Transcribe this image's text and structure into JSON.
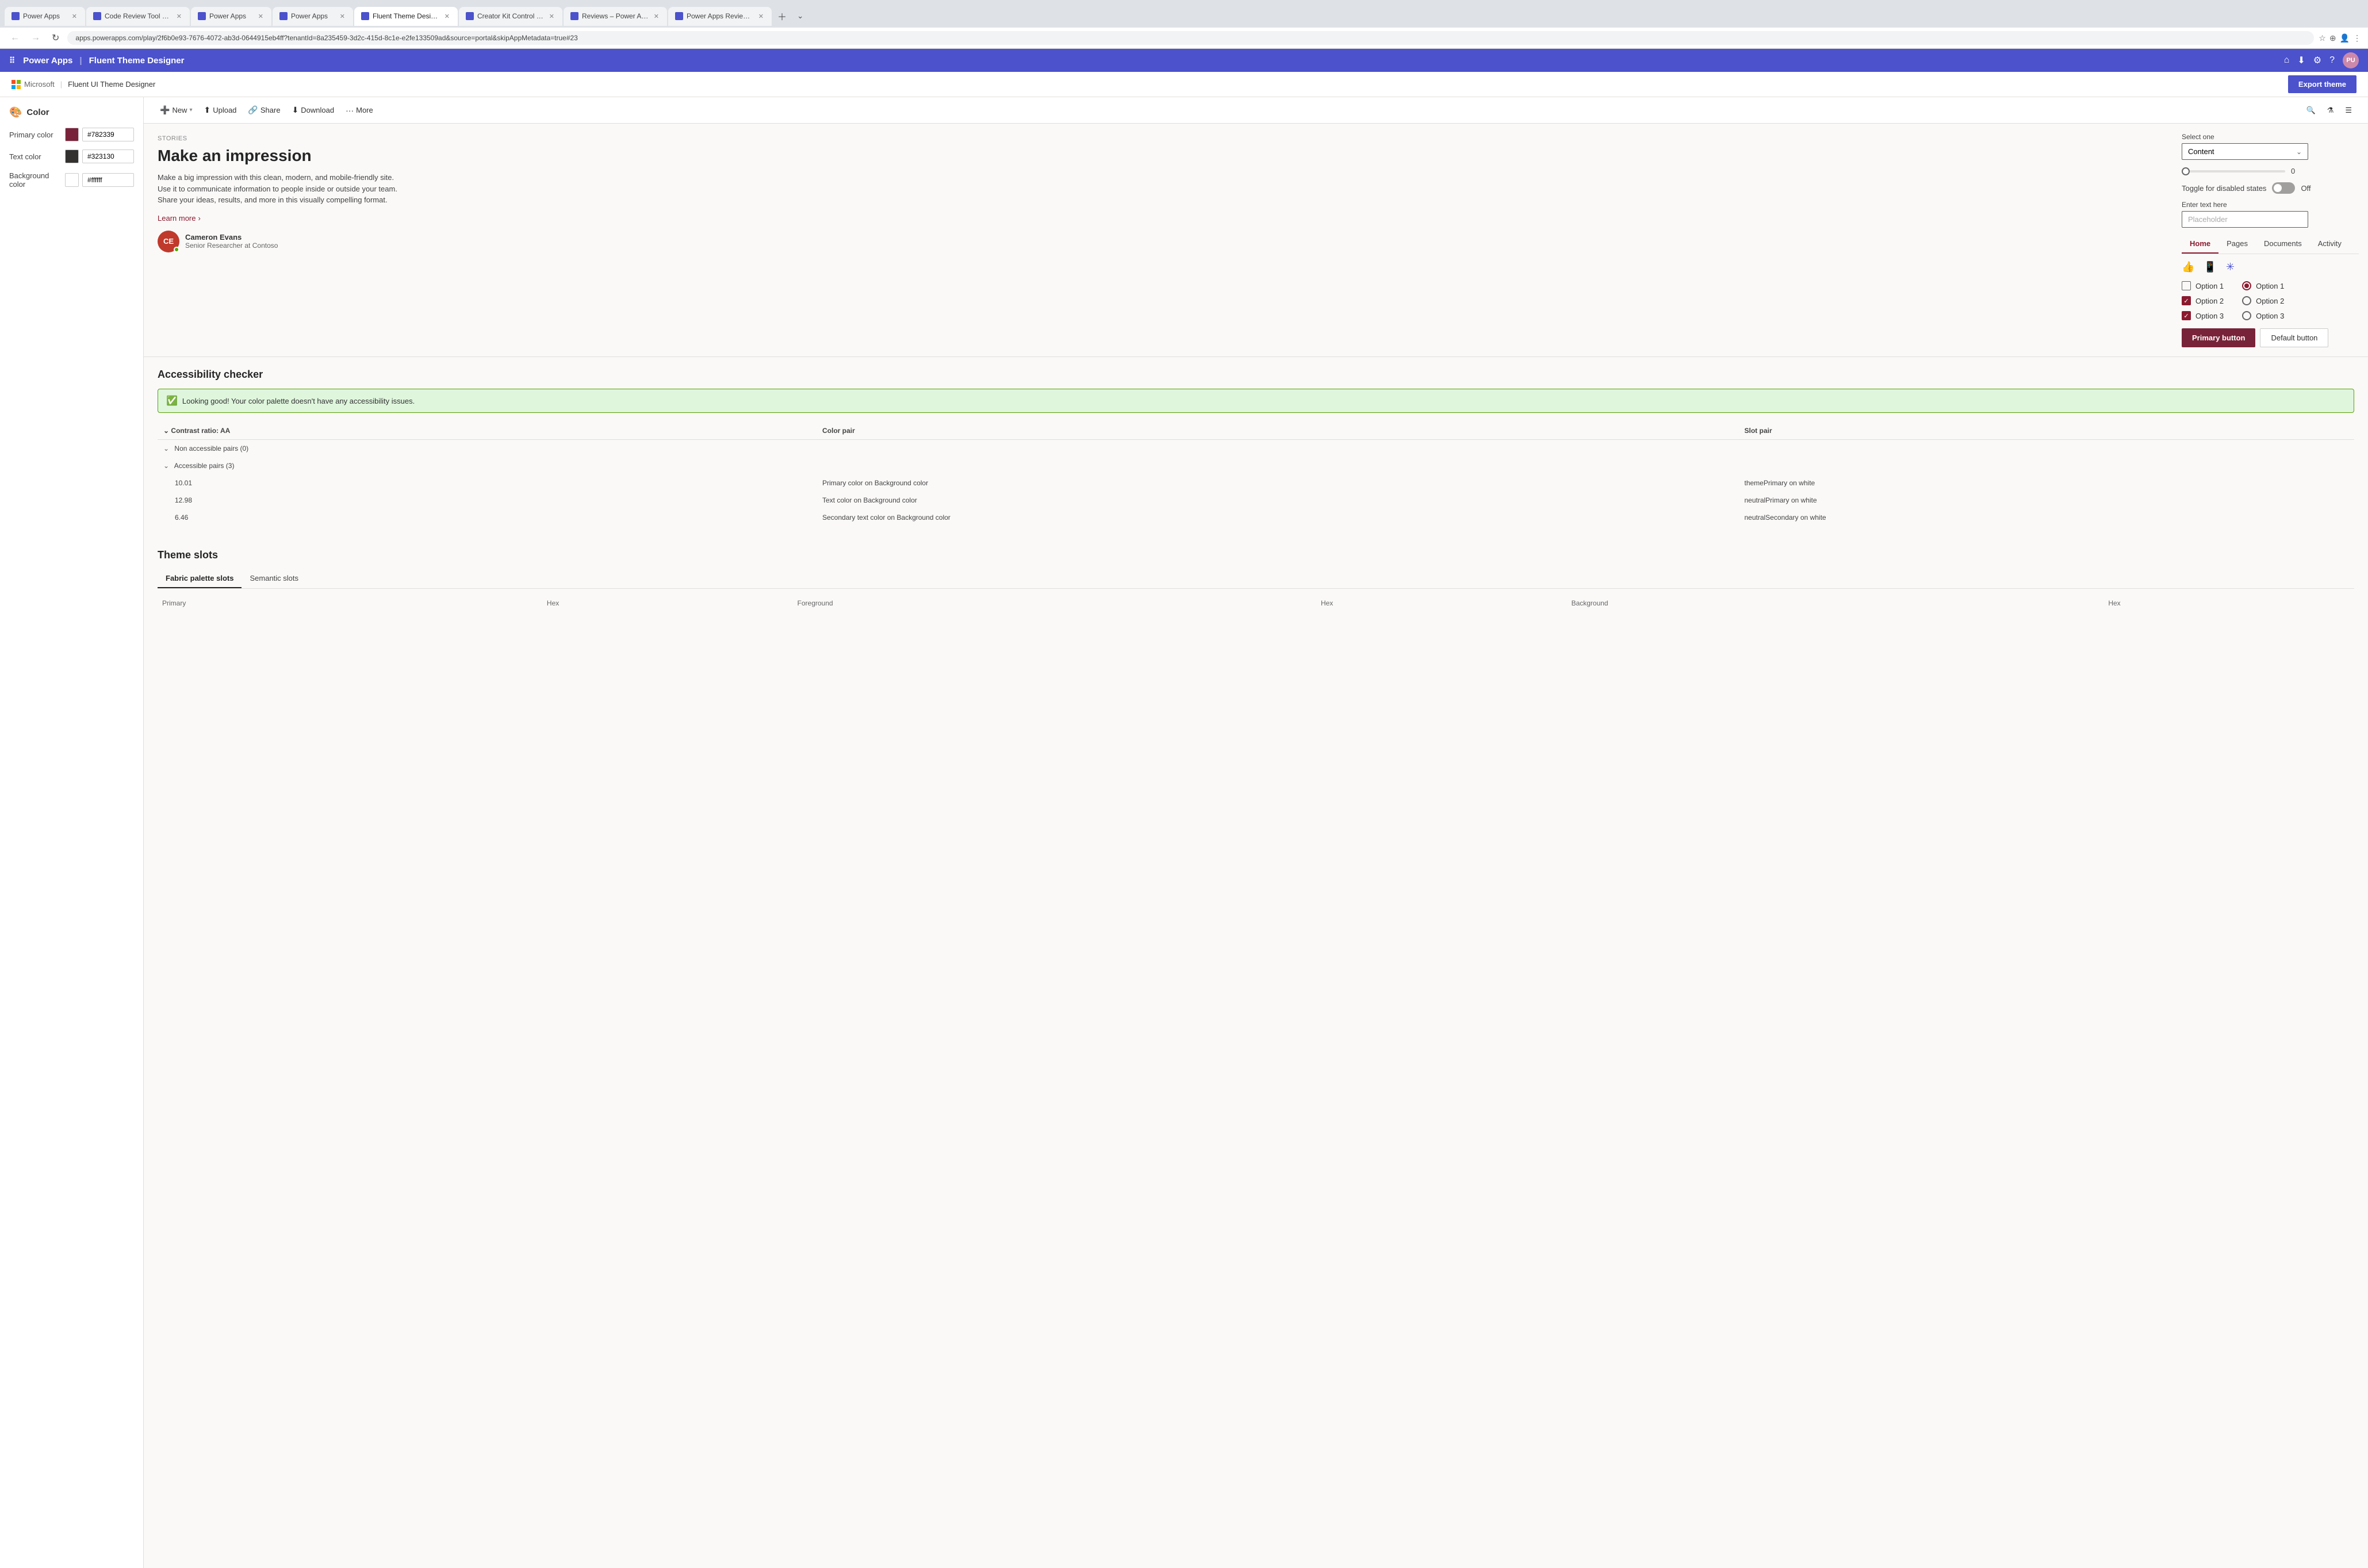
{
  "browser": {
    "tabs": [
      {
        "label": "Power Apps",
        "active": false,
        "favicon_color": "#4b52cc"
      },
      {
        "label": "Code Review Tool Experim...",
        "active": false,
        "favicon_color": "#4b52cc"
      },
      {
        "label": "Power Apps",
        "active": false,
        "favicon_color": "#4b52cc"
      },
      {
        "label": "Power Apps",
        "active": false,
        "favicon_color": "#4b52cc"
      },
      {
        "label": "Fluent Theme Designer -...",
        "active": true,
        "favicon_color": "#4b52cc"
      },
      {
        "label": "Creator Kit Control Refere...",
        "active": false,
        "favicon_color": "#4b52cc"
      },
      {
        "label": "Reviews – Power Apps",
        "active": false,
        "favicon_color": "#4b52cc"
      },
      {
        "label": "Power Apps Review Tool ...",
        "active": false,
        "favicon_color": "#4b52cc"
      }
    ],
    "url": "apps.powerapps.com/play/2f6b0e93-7676-4072-ab3d-0644915eb4ff?tenantId=8a235459-3d2c-415d-8c1e-e2fe133509ad&source=portal&skipAppMetadata=true#23"
  },
  "app_topbar": {
    "title": "Power Apps",
    "separator": "|",
    "subtitle": "Fluent Theme Designer",
    "icons": [
      "waffle",
      "home",
      "download",
      "settings",
      "help",
      "avatar"
    ],
    "avatar_initials": "PU"
  },
  "app_header": {
    "logo_text": "Microsoft",
    "app_title": "Fluent UI Theme Designer",
    "export_button_label": "Export theme"
  },
  "sidebar": {
    "section_title": "Color",
    "colors": [
      {
        "label": "Primary color",
        "value": "#782339",
        "hex_display": "#782339"
      },
      {
        "label": "Text color",
        "value": "#323130",
        "hex_display": "#323130"
      },
      {
        "label": "Background color",
        "value": "#ffffff",
        "hex_display": "#ffffff"
      }
    ]
  },
  "toolbar": {
    "buttons": [
      {
        "label": "New",
        "icon": "➕"
      },
      {
        "label": "Upload",
        "icon": "⬆"
      },
      {
        "label": "Share",
        "icon": "🔗"
      },
      {
        "label": "Download",
        "icon": "⬇"
      },
      {
        "label": "More",
        "icon": "···"
      }
    ],
    "right_icons": [
      "search",
      "filter",
      "list"
    ]
  },
  "preview": {
    "stories_label": "STORIES",
    "headline": "Make an impression",
    "body_text": "Make a big impression with this clean, modern, and mobile-friendly site. Use it to communicate information to people inside or outside your team. Share your ideas, results, and more in this visually compelling format.",
    "learn_more": "Learn more",
    "person": {
      "initials": "CE",
      "name": "Cameron Evans",
      "title": "Senior Researcher at Contoso",
      "bg_color": "#c0392b"
    }
  },
  "controls": {
    "select_label": "Select one",
    "select_value": "Content",
    "text_label": "Enter text here",
    "text_placeholder": "Placeholder",
    "slider_value": 0,
    "toggle_label": "Toggle for disabled states",
    "toggle_state": "Off",
    "tabs": [
      {
        "label": "Home",
        "active": true
      },
      {
        "label": "Pages",
        "active": false
      },
      {
        "label": "Documents",
        "active": false
      },
      {
        "label": "Activity",
        "active": false
      }
    ],
    "action_icons": [
      "👍",
      "📱",
      "⚙"
    ],
    "checkboxes": [
      {
        "label": "Option 1",
        "checked": false
      },
      {
        "label": "Option 2",
        "checked": true
      },
      {
        "label": "Option 3",
        "checked": true
      }
    ],
    "radios": [
      {
        "label": "Option 1",
        "checked": true
      },
      {
        "label": "Option 2",
        "checked": false
      },
      {
        "label": "Option 3",
        "checked": false
      }
    ],
    "primary_button": "Primary button",
    "default_button": "Default button"
  },
  "accessibility": {
    "title": "Accessibility checker",
    "success_message": "Looking good! Your color palette doesn't have any accessibility issues.",
    "table_headers": [
      "Contrast ratio: AA",
      "Color pair",
      "Slot pair"
    ],
    "groups": [
      {
        "label": "Non accessible pairs (0)",
        "rows": []
      },
      {
        "label": "Accessible pairs (3)",
        "rows": [
          {
            "ratio": "10.01",
            "color_pair": "Primary color on Background color",
            "slot_pair": "themePrimary on white"
          },
          {
            "ratio": "12.98",
            "color_pair": "Text color on Background color",
            "slot_pair": "neutralPrimary on white"
          },
          {
            "ratio": "6.46",
            "color_pair": "Secondary text color on Background color",
            "slot_pair": "neutralSecondary on white"
          }
        ]
      }
    ]
  },
  "theme_slots": {
    "title": "Theme slots",
    "tabs": [
      {
        "label": "Fabric palette slots",
        "active": true
      },
      {
        "label": "Semantic slots",
        "active": false
      }
    ],
    "columns": [
      "Primary",
      "Hex",
      "Foreground",
      "Hex",
      "Background",
      "Hex"
    ]
  }
}
